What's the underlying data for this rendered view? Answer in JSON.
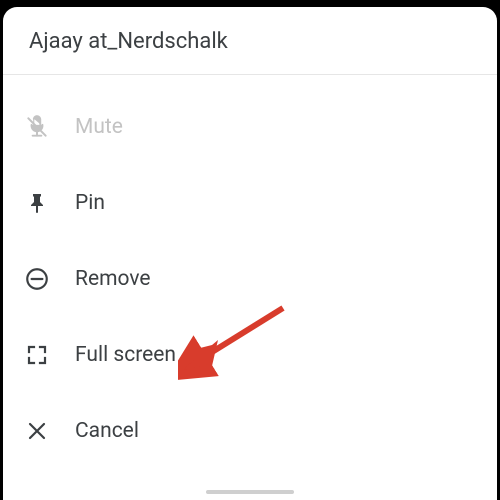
{
  "header": {
    "title": "Ajaay at_Nerdschalk"
  },
  "menu": {
    "mute": {
      "label": "Mute"
    },
    "pin": {
      "label": "Pin"
    },
    "remove": {
      "label": "Remove"
    },
    "fullscreen": {
      "label": "Full screen"
    },
    "cancel": {
      "label": "Cancel"
    }
  },
  "colors": {
    "arrow": "#d83c2c"
  }
}
